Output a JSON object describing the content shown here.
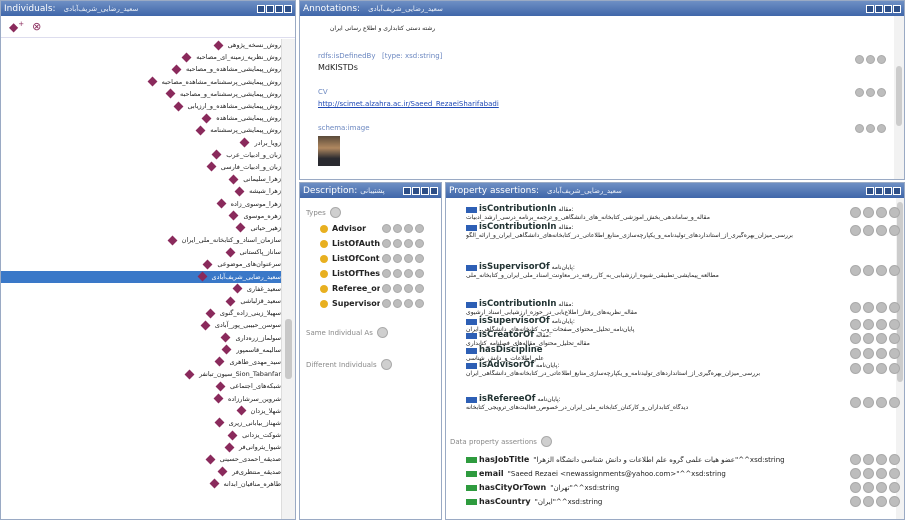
{
  "individuals": {
    "title": "Individuals:",
    "subtitle": "سعید_رضایی_شریف‌آبادی",
    "items": [
      "روش_نسخه_پژوهی",
      "روش_نظریه_زمینه_ای_مصاحبه",
      "روش_پیمایشی_مشاهده_و_مصاحبه",
      "روش_پیمایشی_پرسشنامه_مشاهده_مصاحبه",
      "روش_پیمایشی_پرسشنامه_و_مصاحبه",
      "روش_پیمایشی_مشاهده_و_ارزیابی",
      "روش_پیمایشی_مشاهده",
      "روش_پیمایشی_پرسشنامه",
      "زویا_برادر",
      "زبان_و_ادبیات_عرب",
      "زبان_و_ادبیات_فارسی",
      "زهرا_سلیمانی",
      "زهرا_شیشه",
      "زهرا_موسوی_زاده",
      "زهره_موسوی",
      "زهیر_حیاتی",
      "سازمان_اسناد_و_کتابخانه_ملی_ایران",
      "ساناز_پاکستانی",
      "سرعنوان‌های_موضوعی",
      "سعید_رضایی_شریف‌آبادی",
      "سعید_غفاری",
      "سعید_قزلباشی",
      "سهیلا_زینی_زاده_گنوی",
      "سوسن_حبیبی_پور_آبادی",
      "سولماز_زره‌داری",
      "سالیمه_قاسمپور",
      "سید_مهدی_طاهری",
      "Sion_Tabanfar_سیون_تبانفر",
      "شبکه‌های_اجتماعی",
      "شروین_سرشارزاده",
      "شهلا_یزدان",
      "شهناز_بیابانی_زیری",
      "شوکت_یزدانی",
      "شیوا_یثروانی‌فر",
      "صدیقه_احمدی_حسینی",
      "صدیقه_منتظری‌فر",
      "طاهره_منافیان_ابدانه"
    ],
    "selected_index": 19
  },
  "annotations": {
    "title": "Annotations:",
    "subtitle": "سعید_رضایی_شریف‌آبادی",
    "top_text": "رشته دستی کتابداری و اطلاع رسانی ایران",
    "rows": [
      {
        "label": "rdfs:isDefinedBy",
        "type": "[type: xsd:string]",
        "value": "MdKISTDs"
      },
      {
        "label": "CV",
        "value": "http://scimet.alzahra.ac.ir/Saeed_RezaeiSharifabadi"
      },
      {
        "label": "schema:image"
      }
    ]
  },
  "description": {
    "title": "Description:",
    "subtitle": "پشتیبانی",
    "types_label": "Types",
    "types": [
      "Advisor",
      "ListOfAuth",
      "ListOfCont",
      "ListOfThes",
      "Referee_or",
      "Supervisor"
    ],
    "same_as_label": "Same Individual As",
    "different_label": "Different Individuals"
  },
  "property_assertions": {
    "title": "Property assertions:",
    "subtitle": "سعید_رضایی_شریف‌آبادی",
    "rows": [
      {
        "prop": "isContributionIn",
        "prefix": "مقاله:",
        "text": "مقاله_و_ساماندهی_بخش_آموزشی_کتابخانه_های_دانشگاهی_و_ترجمه_برنامه_درسی_ارشد_ادبیات"
      },
      {
        "prop": "isContributionIn",
        "prefix": "مقاله:",
        "text": "بررسی_میزان_بهره‌گیری_از_استانداردهای_تولیدنامه_و_یکپارچه‌سازی_منابع_اطلاعاتی_در_کتابخانه‌های_دانشگاهی_ایران_و_ارائه_الگو"
      },
      {
        "prop": "isSupervisorOf",
        "prefix": "پایان‌نامه:",
        "text": "مطالعه_پیمایشی_تطبیقی_شیوه_ارزشیابی_به_کار_رفته_در_معاونت_اسناد_ملی_ایران_و_کتابخانه_ملی"
      },
      {
        "prop": "isContributionIn",
        "prefix": "مقاله:",
        "text": "مقاله_نظریه‌های_رفتار_اطلاع‌یابی_در_حوزه_ارزشیابی_اسناد_آرشیوی"
      },
      {
        "prop": "isSupervisorOf",
        "prefix": "پایان‌نامه:",
        "text": "پایان‌نامه_تحلیل_محتوای_صفحات_وب_کتابخانه‌های_دانشگاهی_ایران"
      },
      {
        "prop": "isCreatorOf",
        "prefix": "مقاله:",
        "text": "مقاله_تحلیل_محتوای_مقاله‌های_فصلنامه_کتابداری"
      },
      {
        "prop": "hasDiscipline",
        "prefix": "",
        "text": "علم_اطلاعات_و_دانش_شناسی"
      },
      {
        "prop": "isAdvisorOf",
        "prefix": "پایان‌نامه:",
        "text": "بررسی_میزان_بهره‌گیری_از_استانداردهای_تولیدنامه_و_یکپارچه‌سازی_منابع_اطلاعاتی_در_کتابخانه‌های_دانشگاهی_ایران"
      },
      {
        "prop": "isRefereeOf",
        "prefix": "پایان‌نامه:",
        "text": "دیدگاه_کتابداران_و_کارکنان_کتابخانه_ملی_ایران_در_خصوص_فعالیت‌های_ترویجی_کتابخانه"
      }
    ],
    "data_label": "Data property assertions",
    "data_rows": [
      {
        "prop": "hasJobTitle",
        "value": "\"عضو هیات علمی گروه علم اطلاعات و دانش شناسی دانشگاه الزهرا\"^^xsd:string"
      },
      {
        "prop": "email",
        "value": "\"Saeed Rezaei <newassignments@yahoo.com>\"^^xsd:string"
      },
      {
        "prop": "hasCityOrTown",
        "value": "\"تهران\"^^xsd:string"
      },
      {
        "prop": "hasCountry",
        "value": "\"ایران\"^^xsd:string"
      }
    ]
  }
}
